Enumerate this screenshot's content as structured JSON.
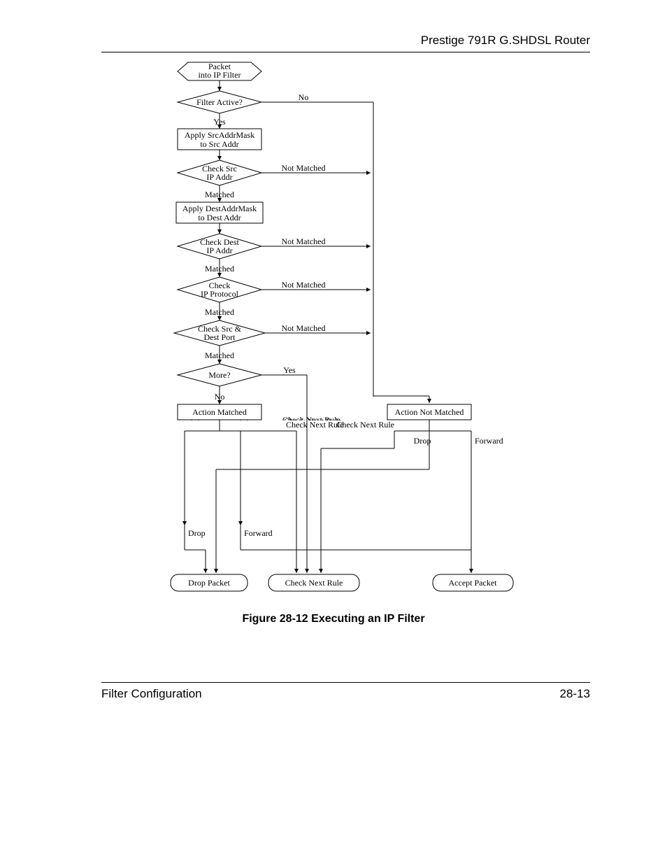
{
  "header": {
    "title": "Prestige 791R G.SHDSL Router"
  },
  "footer": {
    "left": "Filter Configuration",
    "right": "28-13"
  },
  "caption": "Figure 28-12 Executing an IP Filter",
  "flow": {
    "start": {
      "line1": "Packet",
      "line2": "into IP Filter"
    },
    "d1": {
      "text": "Filter Active?",
      "yes": "Yes",
      "no": "No"
    },
    "p1": {
      "line1": "Apply SrcAddrMask",
      "line2": "to  Src Addr"
    },
    "d2": {
      "line1": "Check Src",
      "line2": "IP Addr",
      "right": "Not Matched",
      "down": "Matched"
    },
    "p2": {
      "line1": "Apply DestAddrMask",
      "line2": "to  Dest Addr"
    },
    "d3": {
      "line1": "Check Dest",
      "line2": "IP Addr",
      "right": "Not Matched",
      "down": "Matched"
    },
    "d4": {
      "line1": "Check",
      "line2": "IP Protocol",
      "right": "Not Matched",
      "down": "Matched"
    },
    "d5": {
      "line1": "Check  Src &",
      "line2": "Dest Port",
      "right": "Not Matched",
      "down": "Matched"
    },
    "d6": {
      "text": "More?",
      "yes": "Yes",
      "no": "No"
    },
    "am": {
      "text": "Action Matched",
      "drop": "Drop",
      "fwd": "Forward",
      "cnr": "Check Next Rule"
    },
    "anm": {
      "text": "Action Not Matched",
      "drop": "Drop",
      "fwd": "Forward",
      "cnr": "Check Next Rule"
    },
    "t_drop": "Drop Packet",
    "t_cnr": "Check Next Rule",
    "t_accept": "Accept Packet"
  }
}
